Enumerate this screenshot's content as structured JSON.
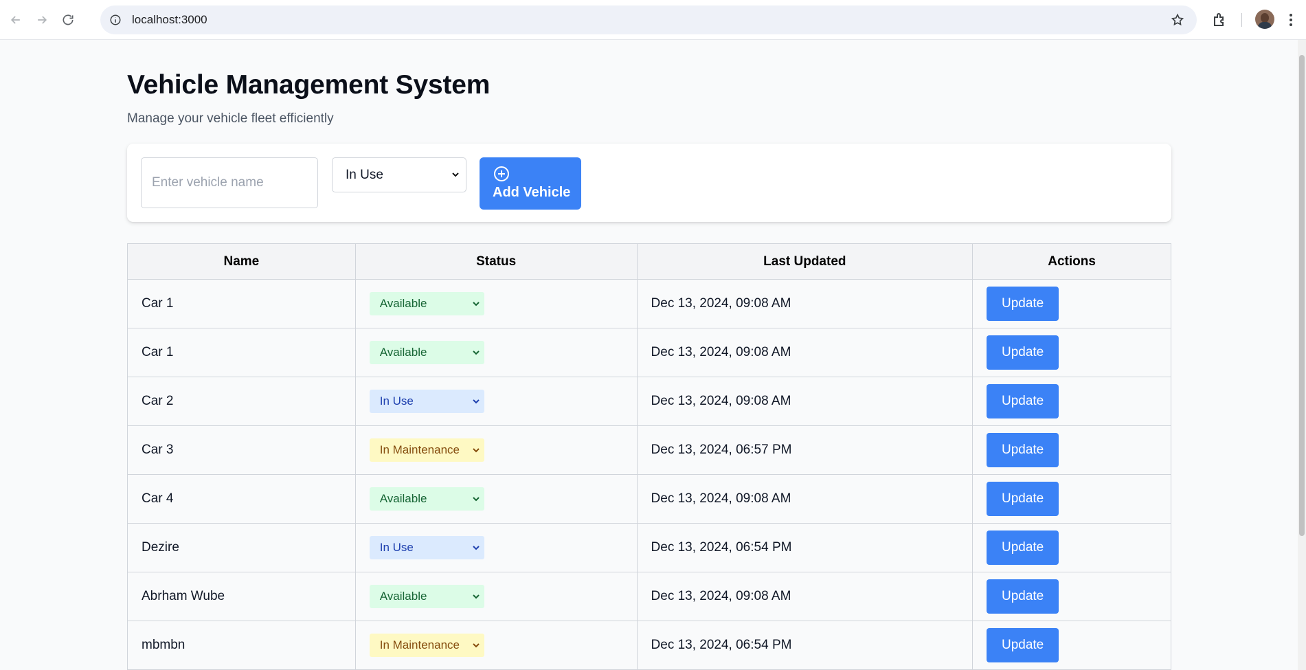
{
  "browser": {
    "url": "localhost:3000"
  },
  "header": {
    "title": "Vehicle Management System",
    "subtitle": "Manage your vehicle fleet efficiently"
  },
  "form": {
    "name_placeholder": "Enter vehicle name",
    "name_value": "",
    "status_selected": "In Use",
    "add_button_label": "Add Vehicle"
  },
  "table": {
    "columns": [
      "Name",
      "Status",
      "Last Updated",
      "Actions"
    ],
    "rows": [
      {
        "name": "Car 1",
        "status": "Available",
        "last_updated": "Dec 13, 2024, 09:08 AM",
        "action": "Update"
      },
      {
        "name": "Car 1",
        "status": "Available",
        "last_updated": "Dec 13, 2024, 09:08 AM",
        "action": "Update"
      },
      {
        "name": "Car 2",
        "status": "In Use",
        "last_updated": "Dec 13, 2024, 09:08 AM",
        "action": "Update"
      },
      {
        "name": "Car 3",
        "status": "In Maintenance",
        "last_updated": "Dec 13, 2024, 06:57 PM",
        "action": "Update"
      },
      {
        "name": "Car 4",
        "status": "Available",
        "last_updated": "Dec 13, 2024, 09:08 AM",
        "action": "Update"
      },
      {
        "name": "Dezire",
        "status": "In Use",
        "last_updated": "Dec 13, 2024, 06:54 PM",
        "action": "Update"
      },
      {
        "name": "Abrham Wube",
        "status": "Available",
        "last_updated": "Dec 13, 2024, 09:08 AM",
        "action": "Update"
      },
      {
        "name": "mbmbn",
        "status": "In Maintenance",
        "last_updated": "Dec 13, 2024, 06:54 PM",
        "action": "Update"
      }
    ]
  },
  "colors": {
    "primary": "#3b82f6",
    "available_bg": "#dcfce7",
    "in_use_bg": "#dbeafe",
    "maintenance_bg": "#fef9c3"
  }
}
